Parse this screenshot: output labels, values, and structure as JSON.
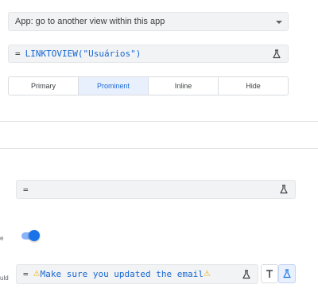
{
  "action_select": {
    "value": "App: go to another view within this app"
  },
  "target_expression": {
    "equals": "=",
    "code": "LINKTOVIEW(\"Usuários\")"
  },
  "prominence": {
    "options": [
      "Primary",
      "Prominent",
      "Inline",
      "Hide"
    ],
    "selected": "Prominent"
  },
  "second_expression": {
    "equals": "=",
    "code": ""
  },
  "toggle": {
    "label_fragment": "e",
    "on": true
  },
  "message_expression": {
    "side_label_fragment": "uld",
    "equals": "=",
    "warn_glyph": "⚠",
    "code": "Make sure you updated the email"
  },
  "colors": {
    "accent": "#1a73e8",
    "code": "#1967d2",
    "field_bg": "#f1f3f4",
    "selected_bg": "#e8f0fe"
  }
}
